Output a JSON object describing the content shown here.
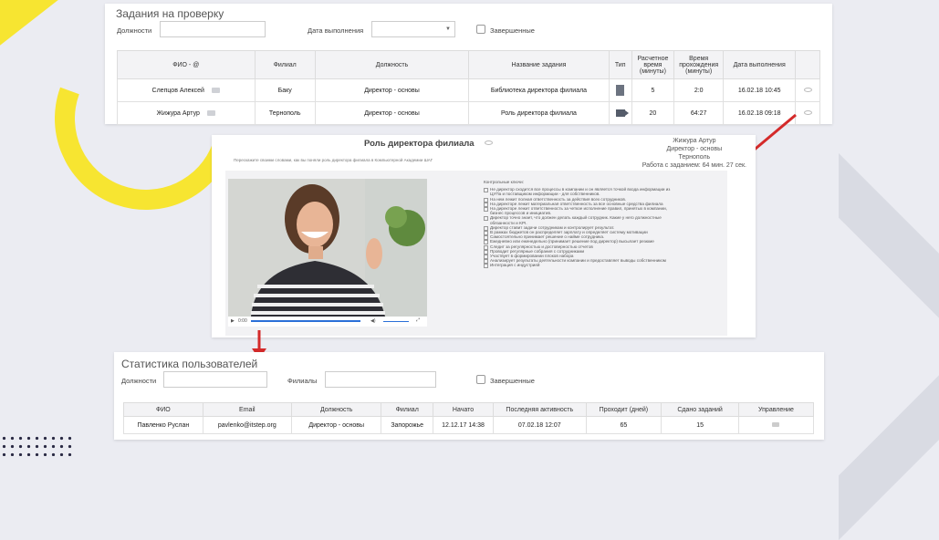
{
  "colors": {
    "accent_red": "#d42a2a",
    "brand_yellow": "#f7e531"
  },
  "review": {
    "title": "Задания на проверку",
    "filters": {
      "position_label": "Должности",
      "due_label": "Дата выполнения",
      "completed_label": "Завершенные"
    },
    "columns": [
      "ФИО - @",
      "Филиал",
      "Должность",
      "Название задания",
      "Тип",
      "Расчетное время (минуты)",
      "Время прохождения (минуты)",
      "Дата выполнения",
      ""
    ],
    "rows": [
      {
        "name": "Слепцов Алексей",
        "branch": "Баку",
        "position": "Директор - основы",
        "task": "Библиотека директора филиала",
        "type_icon": "document-icon",
        "est": "5",
        "time": "2:0",
        "date": "16.02.18 10:45"
      },
      {
        "name": "Жижура Артур",
        "branch": "Тернополь",
        "position": "Директор - основы",
        "task": "Роль директора филиала",
        "type_icon": "video-icon",
        "est": "20",
        "time": "64:27",
        "date": "16.02.18 09:18"
      }
    ]
  },
  "result": {
    "title": "Роль директора филиала",
    "user": "Жижура Артур",
    "position": "Директор - основы",
    "city": "Тернополь",
    "work_time": "Работа с заданием: 64 мин. 27 сек.",
    "instruction": "Перескажите своими словами, как вы поняли роль директора филиала в Компьютерной Академии ШАГ",
    "video_time": "0:00",
    "keys_title": "Контрольные ключи:",
    "keys": [
      "Не директор сходится все процессы в компании и он является точкой входа информации из",
      "ЦУПа и поставщиком информации - для собственников.",
      "На нем лежит полная ответственность за действия всех сотрудников.",
      "На директоре лежит материальная ответственность за все основные средства филиала",
      "На директоре лежит ответственность за четкое исполнение правил, принятых в компании,",
      "бизнес процессов и инициатив.",
      "Директор точно знает, что должен делать каждый сотрудник. Какие у него должностные",
      "обязанности и KPI.",
      "Директор ставит задачи сотрудникам и контролирует результат.",
      "В рамках бюджетов он распределяет зарплату и определяет систему мотивации",
      "Самостоятельно принимает решение о найме сотрудника.",
      "Ежедневно или еженедельно (принимает решение под директор) высылает резюме",
      "Следит за регулярностью и достоверностью отчетов",
      "Проводит регулярные собрания с сотрудниками",
      "Участвует в формировании плоков набора",
      "Анализирует результаты деятельности компании и предоставляет выводы собственником",
      "Интеграция с индустрией"
    ]
  },
  "stats": {
    "title": "Статистика пользователей",
    "filters": {
      "position_label": "Должности",
      "branch_label": "Филиалы",
      "completed_label": "Завершенные"
    },
    "columns": [
      "ФИО",
      "Email",
      "Должность",
      "Филиал",
      "Начато",
      "Последняя активность",
      "Проходит (дней)",
      "Сдано заданий",
      "Управление"
    ],
    "rows": [
      {
        "name": "Павленко Руслан",
        "email": "pavlenko@itstep.org",
        "position": "Директор - основы",
        "branch": "Запорожье",
        "started": "12.12.17 14:38",
        "last": "07.02.18 12:07",
        "days": "65",
        "done": "15"
      }
    ]
  }
}
